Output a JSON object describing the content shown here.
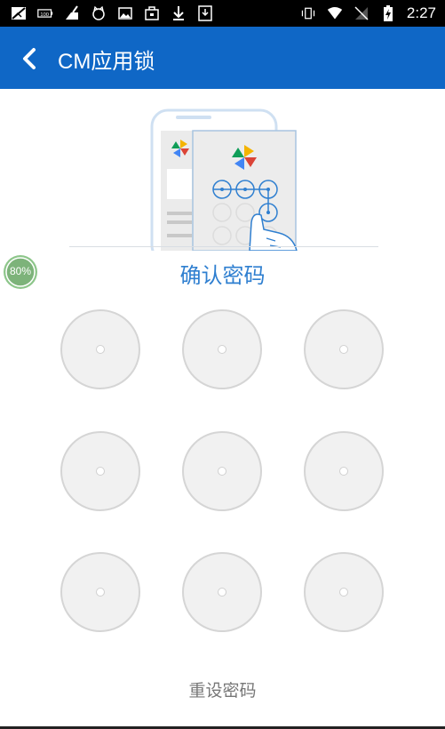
{
  "status_bar": {
    "time": "2:27",
    "icons": [
      "no-signal-image-icon",
      "battery-100-icon",
      "cleaner-icon",
      "cat-icon",
      "image-icon",
      "calendar-bag-icon",
      "download-icon",
      "download-box-icon",
      "vibrate-icon",
      "wifi-icon",
      "no-sim-icon",
      "battery-charging-icon"
    ],
    "battery_level": "100"
  },
  "app_bar": {
    "title": "CM应用锁",
    "back_icon": "chevron-left-icon",
    "color": "#0f67c6"
  },
  "floating_badge": {
    "text": "80%"
  },
  "main": {
    "title": "确认密码",
    "title_color": "#2f7fd0",
    "pattern_dots": 9,
    "reset_label": "重设密码"
  }
}
